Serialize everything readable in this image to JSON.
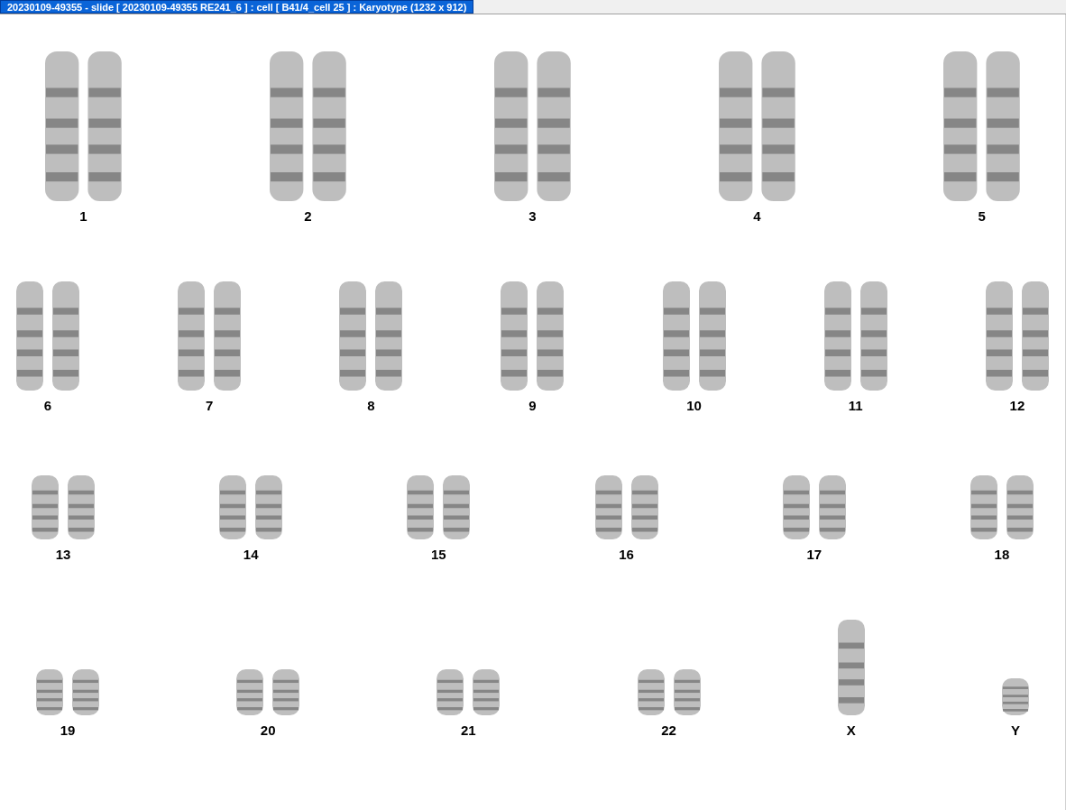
{
  "window": {
    "title": "20230109-49355 - slide [ 20230109-49355 RE241_6 ] : cell [ B41/4_cell 25 ] : Karyotype  (1232 x 912)"
  },
  "karyotype": {
    "rows": [
      {
        "groups": [
          {
            "label": "1",
            "kind": "pair"
          },
          {
            "label": "2",
            "kind": "pair"
          },
          {
            "label": "3",
            "kind": "pair"
          },
          {
            "label": "4",
            "kind": "pair"
          },
          {
            "label": "5",
            "kind": "pair"
          }
        ]
      },
      {
        "groups": [
          {
            "label": "6",
            "kind": "pair"
          },
          {
            "label": "7",
            "kind": "pair"
          },
          {
            "label": "8",
            "kind": "pair"
          },
          {
            "label": "9",
            "kind": "pair"
          },
          {
            "label": "10",
            "kind": "pair"
          },
          {
            "label": "11",
            "kind": "pair"
          },
          {
            "label": "12",
            "kind": "pair"
          }
        ]
      },
      {
        "groups": [
          {
            "label": "13",
            "kind": "pair"
          },
          {
            "label": "14",
            "kind": "pair"
          },
          {
            "label": "15",
            "kind": "pair"
          },
          {
            "label": "16",
            "kind": "pair"
          },
          {
            "label": "17",
            "kind": "pair"
          },
          {
            "label": "18",
            "kind": "pair"
          }
        ]
      },
      {
        "groups": [
          {
            "label": "19",
            "kind": "pair"
          },
          {
            "label": "20",
            "kind": "pair"
          },
          {
            "label": "21",
            "kind": "pair"
          },
          {
            "label": "22",
            "kind": "pair"
          },
          {
            "label": "X",
            "kind": "single"
          },
          {
            "label": "Y",
            "kind": "single"
          }
        ]
      }
    ]
  }
}
